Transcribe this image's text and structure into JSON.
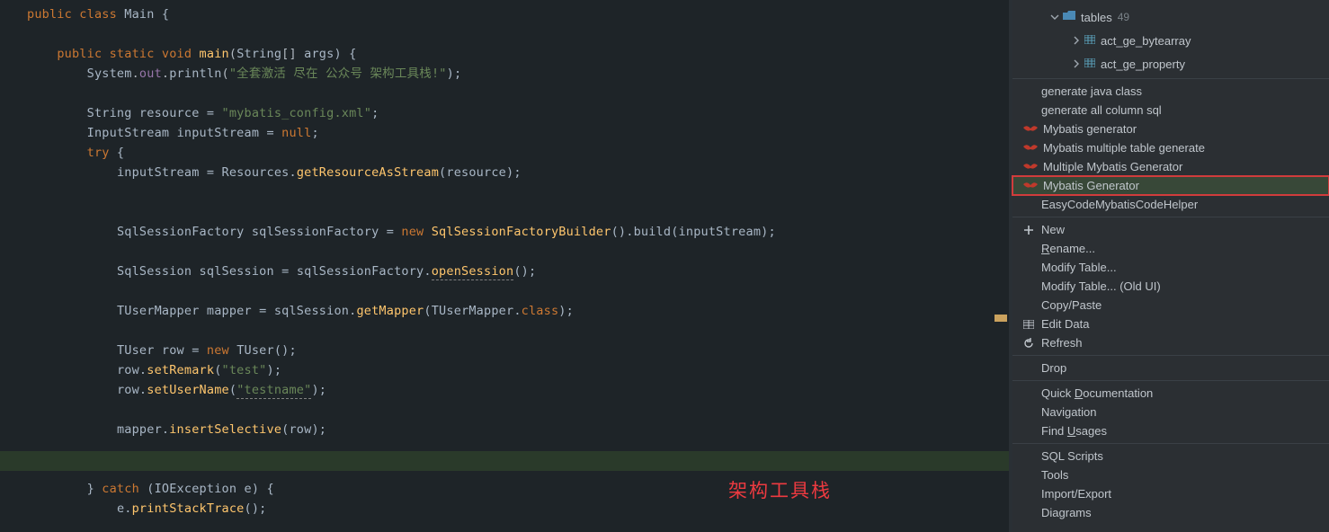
{
  "editor": {
    "watermark": "架构工具栈",
    "code": {
      "line1_kw_public": "public",
      "line1_kw_class": "class",
      "line1_name": "Main",
      "line1_brace": " {",
      "line3_kw_public": "public",
      "line3_kw_static": "static",
      "line3_kw_void": "void",
      "line3_method": "main",
      "line3_type_string": "String",
      "line3_param": "args",
      "line3_end": ") {",
      "line4_sys": "System",
      "line4_out": "out",
      "line4_println": "println",
      "line4_str": "\"全套激活 尽在 公众号 架构工具栈!\"",
      "line4_end": ");",
      "line6_type": "String",
      "line6_var": "resource",
      "line6_eq": " = ",
      "line6_str": "\"mybatis_config.xml\"",
      "line6_end": ";",
      "line7_type": "InputStream",
      "line7_var": "inputStream",
      "line7_eq": " = ",
      "line7_null": "null",
      "line7_end": ";",
      "line8_try": "try",
      "line8_brace": " {",
      "line9_var": "inputStream",
      "line9_eq": " = ",
      "line9_class": "Resources",
      "line9_dot": ".",
      "line9_method": "getResourceAsStream",
      "line9_lp": "(",
      "line9_arg": "resource",
      "line9_rp": ");",
      "line12_type": "SqlSessionFactory",
      "line12_var": "sqlSessionFactory",
      "line12_eq": " = ",
      "line12_new": "new",
      "line12_class": "SqlSessionFactoryBuilder",
      "line12_paren": "().",
      "line12_method": "build",
      "line12_lp": "(",
      "line12_arg": "inputStream",
      "line12_rp": ");",
      "line14_type": "SqlSession",
      "line14_var": "sqlSession",
      "line14_eq": " = ",
      "line14_factory": "sqlSessionFactory",
      "line14_dot": ".",
      "line14_method": "openSession",
      "line14_end": "();",
      "line16_type": "TUserMapper",
      "line16_var": "mapper",
      "line16_eq": " = ",
      "line16_session": "sqlSession",
      "line16_dot": ".",
      "line16_method": "getMapper",
      "line16_lp": "(",
      "line16_arg": "TUserMapper",
      "line16_dot2": ".",
      "line16_class": "class",
      "line16_rp": ");",
      "line18_type": "TUser",
      "line18_var": "row",
      "line18_eq": " = ",
      "line18_new": "new",
      "line18_ctor": "TUser",
      "line18_end": "();",
      "line19_var": "row",
      "line19_dot": ".",
      "line19_method": "setRemark",
      "line19_lp": "(",
      "line19_str": "\"test\"",
      "line19_rp": ");",
      "line20_var": "row",
      "line20_dot": ".",
      "line20_method": "setUserName",
      "line20_lp": "(",
      "line20_str": "\"testname\"",
      "line20_rp": ");",
      "line22_var": "mapper",
      "line22_dot": ".",
      "line22_method": "insertSelective",
      "line22_lp": "(",
      "line22_arg": "row",
      "line22_rp": ");",
      "line25_brace": "}",
      "line25_catch": "catch",
      "line25_lp": " (",
      "line25_type": "IOException",
      "line25_var": "e",
      "line25_rp": ") {",
      "line26_var": "e",
      "line26_dot": ".",
      "line26_method": "printStackTrace",
      "line26_end": "();"
    }
  },
  "tree": {
    "folder_label": "tables",
    "folder_count": "49",
    "table1": "act_ge_bytearray",
    "table2": "act_ge_property"
  },
  "menu": {
    "items": [
      "generate java class",
      "generate all column sql",
      "Mybatis generator",
      "Mybatis multiple table generate",
      "Multiple Mybatis Generator",
      "Mybatis Generator",
      "EasyCodeMybatisCodeHelper",
      "New",
      "Rename...",
      "Modify Table...",
      "Modify Table... (Old UI)",
      "Copy/Paste",
      "Edit Data",
      "Refresh",
      "Drop",
      "Quick Documentation",
      "Navigation",
      "Find Usages",
      "SQL Scripts",
      "Tools",
      "Import/Export",
      "Diagrams"
    ]
  }
}
